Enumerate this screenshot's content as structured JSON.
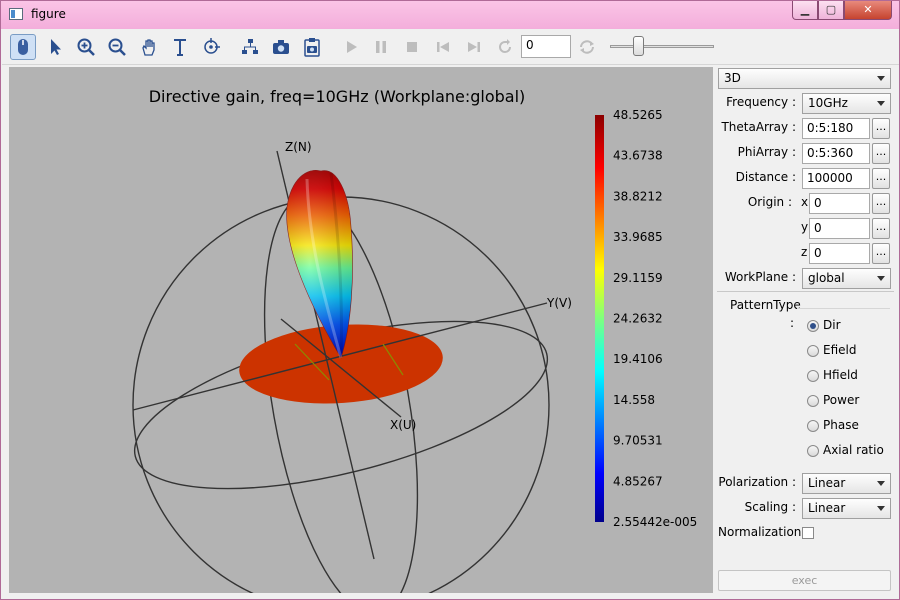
{
  "window": {
    "title": "figure",
    "minimize": "▁",
    "maximize": "▢",
    "close": "✕"
  },
  "toolbar": {
    "frame_value": "0",
    "slider_value": 0.25
  },
  "plot": {
    "title": "Directive gain, freq=10GHz (Workplane:global)",
    "axis_z": "Z(N)",
    "axis_y": "Y(V)",
    "axis_x": "X(U)",
    "colorbar_ticks": [
      "48.5265",
      "43.6738",
      "38.8212",
      "33.9685",
      "29.1159",
      "24.2632",
      "19.4106",
      "14.558",
      "9.70531",
      "4.85267",
      "2.55442e-005"
    ]
  },
  "panel": {
    "view_mode": "3D",
    "frequency_label": "Frequency :",
    "frequency_value": "10GHz",
    "theta_label": "ThetaArray :",
    "theta_value": "0:5:180",
    "phi_label": "PhiArray :",
    "phi_value": "0:5:360",
    "distance_label": "Distance :",
    "distance_value": "100000",
    "origin_label": "Origin :",
    "origin_x_label": "x",
    "origin_x": "0",
    "origin_y_label": "y",
    "origin_y": "0",
    "origin_z_label": "z",
    "origin_z": "0",
    "workplane_label": "WorkPlane :",
    "workplane_value": "global",
    "pattern_label": "PatternType",
    "pattern_colon": ":",
    "pattern_options": [
      "Dir",
      "Efield",
      "Hfield",
      "Power",
      "Phase",
      "Axial ratio"
    ],
    "polarization_label": "Polarization :",
    "polarization_value": "Linear",
    "scaling_label": "Scaling :",
    "scaling_value": "Linear",
    "normalization_label": "Normalization",
    "exec_label": "exec",
    "browse_label": "..."
  }
}
